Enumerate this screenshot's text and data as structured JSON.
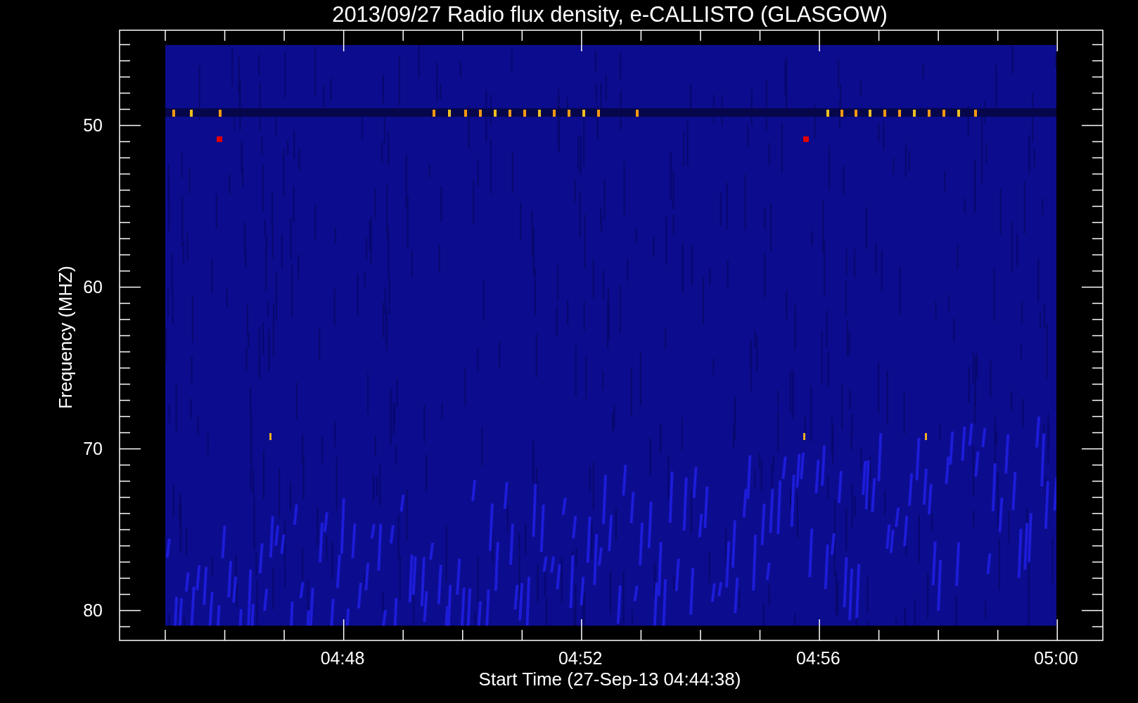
{
  "title": "2013/09/27  Radio flux density, e-CALLISTO (GLASGOW)",
  "y_axis": {
    "label": "Frequency (MHZ)",
    "ticks": [
      "50",
      "60",
      "70",
      "80"
    ]
  },
  "x_axis": {
    "label": "Start Time (27-Sep-13 04:44:38)",
    "ticks": [
      "04:48",
      "04:52",
      "04:56",
      "05:00"
    ]
  }
}
